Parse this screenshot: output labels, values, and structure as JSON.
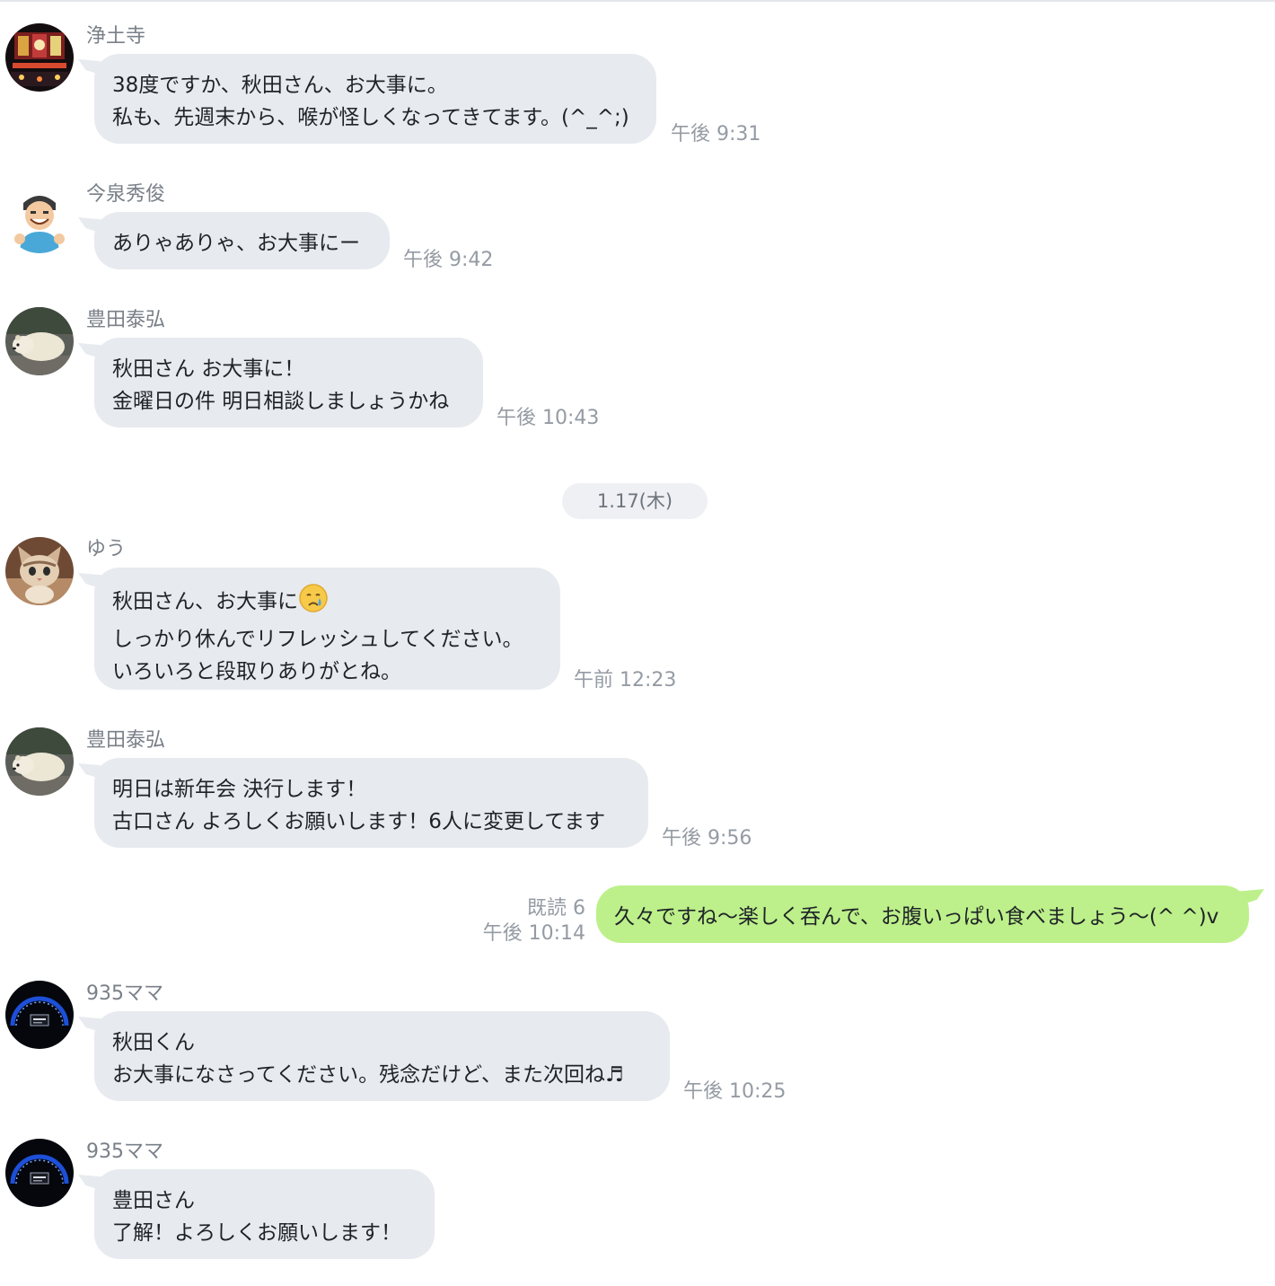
{
  "date_separator": "1.17(木)",
  "messages": [
    {
      "sender": "浄土寺",
      "avatar_icon": "night-street-photo-avatar",
      "lines": [
        "38度ですか、秋田さん、お大事に。",
        "私も、先週末から、喉が怪しくなってきてます。(^_^;)"
      ],
      "time": "午後 9:31"
    },
    {
      "sender": "今泉秀俊",
      "avatar_icon": "cartoon-man-thumbs-up-avatar",
      "lines": [
        "ありゃありゃ、お大事にー"
      ],
      "time": "午後 9:42"
    },
    {
      "sender": "豊田泰弘",
      "avatar_icon": "polar-bear-avatar",
      "lines": [
        "秋田さん お大事に！",
        "金曜日の件 明日相談しましょうかね"
      ],
      "time": "午後 10:43"
    },
    {
      "sender": "ゆう",
      "avatar_icon": "kitten-avatar",
      "lines": [
        "秋田さん、お大事に",
        "しっかり休んでリフレッシュしてください。",
        "いろいろと段取りありがとね。"
      ],
      "emoji": "crying-face-icon",
      "time": "午前 12:23"
    },
    {
      "sender": "豊田泰弘",
      "avatar_icon": "polar-bear-avatar",
      "lines": [
        "明日は新年会 決行します！",
        "古口さん よろしくお願いします！6人に変更してます"
      ],
      "time": "午後 9:56"
    },
    {
      "sender": "",
      "lines": [
        "久々ですね〜楽しく呑んで、お腹いっぱい食べましょう〜(^ ^)v"
      ],
      "read_label": "既読 6",
      "time": "午後 10:14"
    },
    {
      "sender": "935ママ",
      "avatar_icon": "speedometer-avatar",
      "lines": [
        "秋田くん",
        "お大事になさってください。残念だけど、また次回ね♬"
      ],
      "time": "午後 10:25"
    },
    {
      "sender": "935ママ",
      "avatar_icon": "speedometer-avatar",
      "lines": [
        "豊田さん",
        "了解！よろしくお願いします！"
      ],
      "time": ""
    }
  ],
  "colors": {
    "incoming_bubble": "#e7eaee",
    "outgoing_bubble": "#bdf08a",
    "timestamp": "#959ba3"
  }
}
